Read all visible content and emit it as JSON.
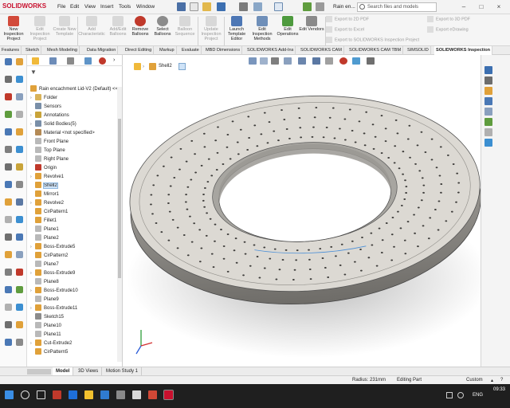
{
  "app": {
    "logo": "SOLIDWORKS",
    "doc_title": "Rain en...",
    "search_placeholder": "Search files and models"
  },
  "menu": [
    "File",
    "Edit",
    "View",
    "Insert",
    "Tools",
    "Window"
  ],
  "ribbon": {
    "buttons": [
      {
        "label": "New Inspection Project",
        "enabled": true
      },
      {
        "label": "Edit Inspection Project",
        "enabled": false
      },
      {
        "label": "Create New Template",
        "enabled": false
      },
      {
        "label": "Add Characteristic",
        "enabled": false
      },
      {
        "label": "Add/Edit Balloons",
        "enabled": false
      },
      {
        "label": "Remove Balloons",
        "enabled": true
      },
      {
        "label": "Select Balloons",
        "enabled": true
      },
      {
        "label": "Balloon Sequence",
        "enabled": false
      },
      {
        "label": "Update Inspection Project",
        "enabled": false
      },
      {
        "label": "Launch Template Editor",
        "enabled": true
      },
      {
        "label": "Edit Inspection Methods",
        "enabled": true
      },
      {
        "label": "Edit Operations",
        "enabled": true
      },
      {
        "label": "Edit Vendors",
        "enabled": true
      }
    ],
    "exports_left": [
      "Export to 2D PDF",
      "Export to Excel",
      "Export to SOLIDWORKS Inspection Project"
    ],
    "exports_right": [
      "Export to 3D PDF",
      "Export eDrawing"
    ]
  },
  "tabs": {
    "items": [
      "Features",
      "Sketch",
      "Mesh Modeling",
      "Data Migration",
      "Direct Editing",
      "Markup",
      "Evaluate",
      "MBD Dimensions",
      "SOLIDWORKS Add-Ins",
      "SOLIDWORKS CAM",
      "SOLIDWORKS CAM TBM",
      "SIMSOLID",
      "SOLIDWORKS Inspection"
    ],
    "active": "SOLIDWORKS Inspection"
  },
  "breadcrumb": {
    "label": "Shell2"
  },
  "tree": {
    "root": "Rain encachment Lid-V2 (Default) <<",
    "items": [
      {
        "label": "Folder",
        "icon": "folder-icon",
        "expand": true,
        "color": "#d9b35a"
      },
      {
        "label": "Sensors",
        "icon": "sensor-icon",
        "expand": false,
        "color": "#7a8fa8"
      },
      {
        "label": "Annotations",
        "icon": "annotation-icon",
        "expand": true,
        "color": "#c9a43a"
      },
      {
        "label": "Solid Bodies(5)",
        "icon": "solid-bodies-icon",
        "expand": true,
        "color": "#7a8fa8"
      },
      {
        "label": "Material <not specified>",
        "icon": "material-icon",
        "expand": false,
        "color": "#b48a55"
      },
      {
        "label": "Front Plane",
        "icon": "plane-icon",
        "expand": false,
        "color": "#b9b9b9"
      },
      {
        "label": "Top Plane",
        "icon": "plane-icon",
        "expand": false,
        "color": "#b9b9b9"
      },
      {
        "label": "Right Plane",
        "icon": "plane-icon",
        "expand": false,
        "color": "#b9b9b9"
      },
      {
        "label": "Origin",
        "icon": "origin-icon",
        "expand": false,
        "color": "#c0392b"
      },
      {
        "label": "Revolve1",
        "icon": "revolve-icon",
        "expand": true,
        "color": "#e0a13a"
      },
      {
        "label": "Shell2",
        "icon": "shell-icon",
        "expand": false,
        "color": "#e0a13a",
        "selected": true
      },
      {
        "label": "Mirror1",
        "icon": "mirror-icon",
        "expand": false,
        "color": "#e0a13a"
      },
      {
        "label": "Revolve2",
        "icon": "revolve-icon",
        "expand": true,
        "color": "#e0a13a"
      },
      {
        "label": "CirPattern1",
        "icon": "circular-pattern-icon",
        "expand": false,
        "color": "#e0a13a"
      },
      {
        "label": "Fillet1",
        "icon": "fillet-icon",
        "expand": false,
        "color": "#e0a13a"
      },
      {
        "label": "Plane1",
        "icon": "plane-icon",
        "expand": false,
        "color": "#b9b9b9"
      },
      {
        "label": "Plane2",
        "icon": "plane-icon",
        "expand": false,
        "color": "#b9b9b9"
      },
      {
        "label": "Boss-Extrude5",
        "icon": "extrude-icon",
        "expand": true,
        "color": "#e0a13a"
      },
      {
        "label": "CirPattern2",
        "icon": "circular-pattern-icon",
        "expand": false,
        "color": "#e0a13a"
      },
      {
        "label": "Plane7",
        "icon": "plane-icon",
        "expand": false,
        "color": "#b9b9b9"
      },
      {
        "label": "Boss-Extrude9",
        "icon": "extrude-icon",
        "expand": true,
        "color": "#e0a13a"
      },
      {
        "label": "Plane8",
        "icon": "plane-icon",
        "expand": false,
        "color": "#b9b9b9"
      },
      {
        "label": "Boss-Extrude10",
        "icon": "extrude-icon",
        "expand": true,
        "color": "#e0a13a"
      },
      {
        "label": "Plane9",
        "icon": "plane-icon",
        "expand": false,
        "color": "#b9b9b9"
      },
      {
        "label": "Boss-Extrude11",
        "icon": "extrude-icon",
        "expand": true,
        "color": "#e0a13a"
      },
      {
        "label": "Sketch15",
        "icon": "sketch-icon",
        "expand": false,
        "color": "#8c8c8c"
      },
      {
        "label": "Plane10",
        "icon": "plane-icon",
        "expand": false,
        "color": "#b9b9b9"
      },
      {
        "label": "Plane11",
        "icon": "plane-icon",
        "expand": false,
        "color": "#b9b9b9"
      },
      {
        "label": "Cut-Extrude2",
        "icon": "cut-extrude-icon",
        "expand": true,
        "color": "#e0a13a"
      },
      {
        "label": "CirPattern5",
        "icon": "circular-pattern-icon",
        "expand": false,
        "color": "#e0a13a"
      }
    ]
  },
  "bottom_tabs": {
    "items": [
      "Model",
      "3D Views",
      "Motion Study 1"
    ],
    "active": "Model"
  },
  "status": {
    "radius": "Radius: 231mm",
    "mode": "Editing Part",
    "units": "Custom"
  },
  "taskbar": {
    "lang": "ENG",
    "time": "09:33"
  },
  "colors": {
    "accent": "#c8102e",
    "selection": "#cfe3f7",
    "part": "#d9d6d0",
    "taskbar": "#1f1f1f"
  }
}
